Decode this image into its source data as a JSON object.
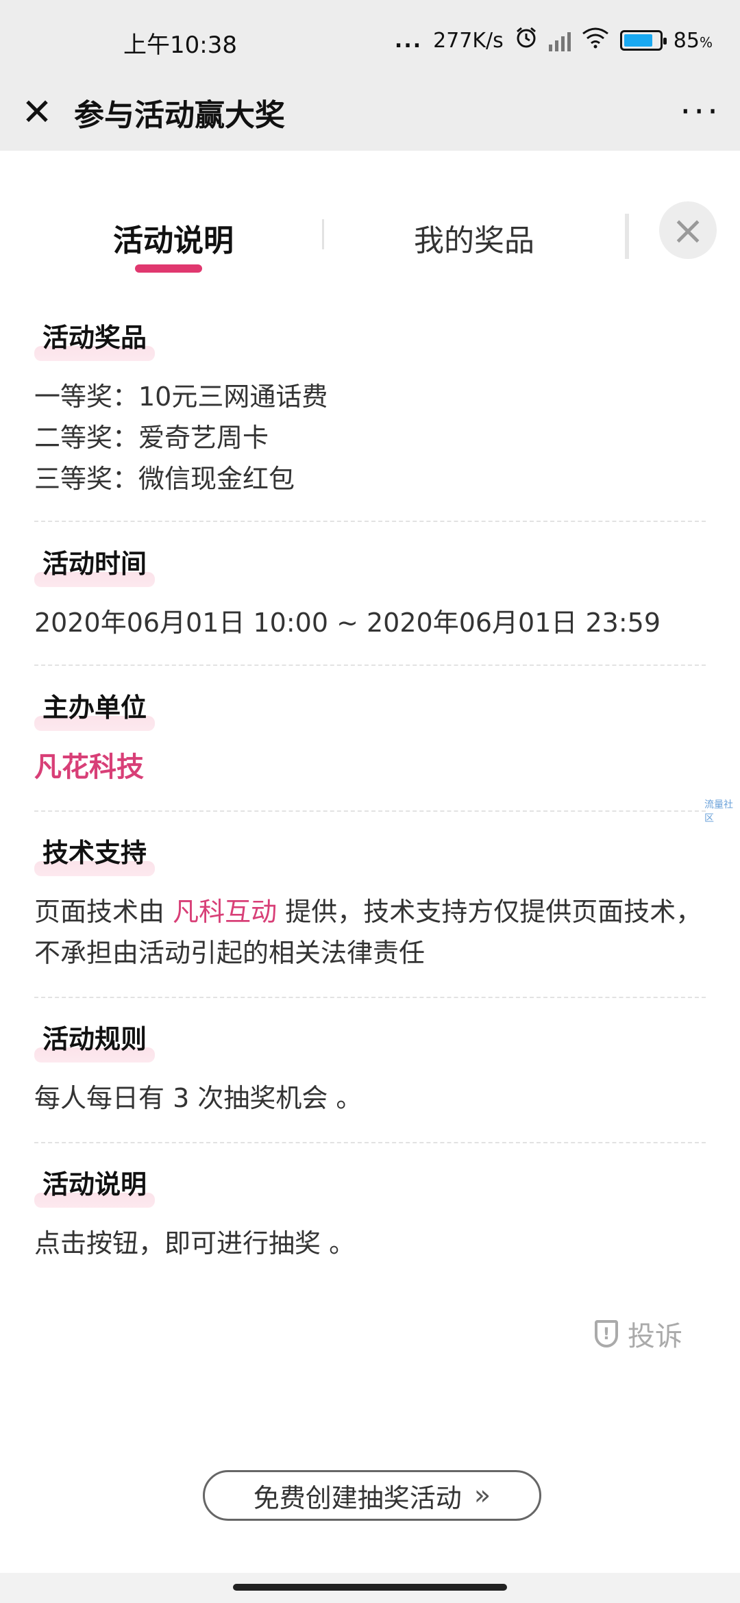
{
  "status_bar": {
    "time": "上午10:38",
    "dots": "...",
    "speed": "277K/s",
    "battery": "85",
    "battery_unit": "%",
    "battery_level": 0.85
  },
  "header": {
    "close_icon": "close-icon",
    "title": "参与活动赢大奖",
    "more": "···"
  },
  "tabs": [
    {
      "label": "活动说明",
      "active": true
    },
    {
      "label": "我的奖品",
      "active": false
    }
  ],
  "panel_close": "×",
  "sections": {
    "prizes": {
      "title": "活动奖品",
      "lines": [
        "一等奖：10元三网通话费",
        "二等奖：爱奇艺周卡",
        "三等奖：微信现金红包"
      ]
    },
    "time": {
      "title": "活动时间",
      "text": "2020年06月01日 10:00 ~ 2020年06月01日 23:59"
    },
    "organizer": {
      "title": "主办单位",
      "text": "凡花科技"
    },
    "tech": {
      "title": "技术支持",
      "prefix": "页面技术由 ",
      "highlight": "凡科互动",
      "suffix": " 提供，技术支持方仅提供页面技术，不承担由活动引起的相关法律责任"
    },
    "rules": {
      "title": "活动规则",
      "text": "每人每日有 3 次抽奖机会 。"
    },
    "desc": {
      "title": "活动说明",
      "text": "点击按钮，即可进行抽奖 。"
    }
  },
  "watermark": "流量社区",
  "complain": "投诉",
  "create_button": "免费创建抽奖活动",
  "create_chevron": "»",
  "colors": {
    "accent": "#e0386f",
    "brand": "#d83f77",
    "battery": "#1aa9f1"
  }
}
